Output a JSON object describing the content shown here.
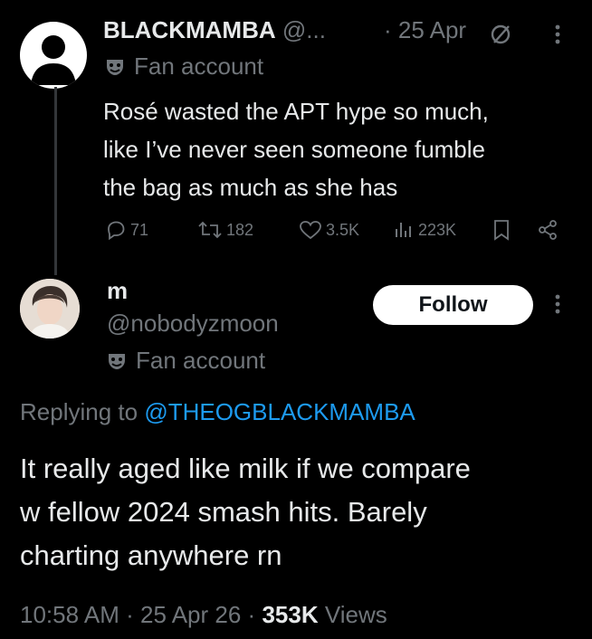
{
  "tweet1": {
    "display_name": "BLACKMAMBA",
    "handle_truncated": "@...",
    "separator": "·",
    "date": "25 Apr",
    "label": "Fan account",
    "text_lines": [
      "Rosé wasted the APT hype so much,",
      "like I’ve never seen someone fumble",
      "the bag as much as she has"
    ],
    "actions": {
      "replies": "71",
      "reposts": "182",
      "likes": "3.5K",
      "views": "223K"
    }
  },
  "tweet2": {
    "display_name": "m",
    "handle": "@nobodyzmoon",
    "label": "Fan account",
    "follow_label": "Follow",
    "replying_prefix": "Replying to",
    "replying_to": "@THEOGBLACKMAMBA",
    "text_lines": [
      "It really aged like milk if we compare",
      "w fellow 2024 smash hits. Barely",
      "charting anywhere rn"
    ],
    "meta": {
      "time": "10:58 AM",
      "sep1": "·",
      "date": "25 Apr 26",
      "sep2": "·",
      "views_count": "353K",
      "views_label": "Views"
    }
  },
  "colors": {
    "background": "#000000",
    "text": "#e7e9ea",
    "muted": "#71767b",
    "link": "#1d9bf0",
    "button_bg": "#ffffff"
  },
  "icons": [
    "default-avatar-icon",
    "no-entry-icon",
    "more-icon",
    "mask-icon",
    "reply-icon",
    "repost-icon",
    "like-icon",
    "views-icon",
    "bookmark-icon",
    "share-icon"
  ]
}
